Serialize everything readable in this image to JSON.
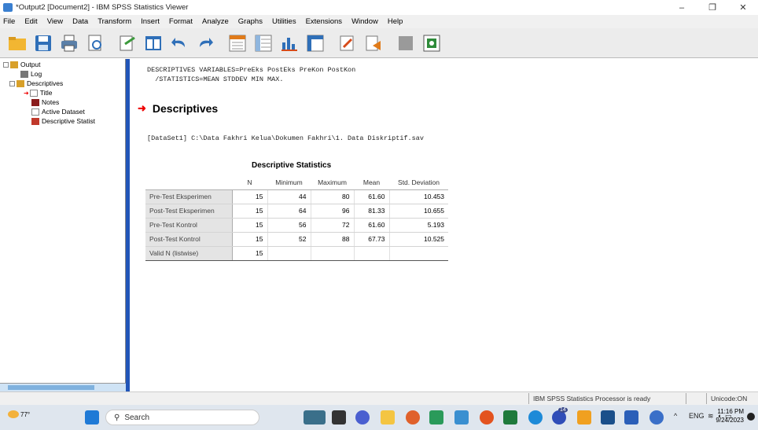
{
  "window": {
    "title": "*Output2 [Document2] - IBM SPSS Statistics Viewer",
    "minimize": "–",
    "maximize": "❐",
    "close": "✕"
  },
  "menu": [
    "File",
    "Edit",
    "View",
    "Data",
    "Transform",
    "Insert",
    "Format",
    "Analyze",
    "Graphs",
    "Utilities",
    "Extensions",
    "Window",
    "Help"
  ],
  "nav": {
    "items": [
      "Output",
      "Log",
      "Descriptives",
      "Title",
      "Notes",
      "Active Dataset",
      "Descriptive Statist"
    ]
  },
  "syntax": "DESCRIPTIVES VARIABLES=PreEks PostEks PreKon PostKon\n  /STATISTICS=MEAN STDDEV MIN MAX.",
  "section_heading": "Descriptives",
  "dataset_line": "[DataSet1] C:\\Data Fakhri Kelua\\Dokumen Fakhri\\1. Data Diskriptif.sav",
  "table": {
    "title": "Descriptive Statistics",
    "headers": [
      "",
      "N",
      "Minimum",
      "Maximum",
      "Mean",
      "Std. Deviation"
    ],
    "rows": [
      [
        "Pre-Test Eksperimen",
        "15",
        "44",
        "80",
        "61.60",
        "10.453"
      ],
      [
        "Post-Test Eksperimen",
        "15",
        "64",
        "96",
        "81.33",
        "10.655"
      ],
      [
        "Pre-Test Kontrol",
        "15",
        "56",
        "72",
        "61.60",
        "5.193"
      ],
      [
        "Post-Test Kontrol",
        "15",
        "52",
        "88",
        "67.73",
        "10.525"
      ],
      [
        "Valid N (listwise)",
        "15",
        "",
        "",
        "",
        ""
      ]
    ]
  },
  "status": {
    "processor": "IBM SPSS Statistics Processor is ready",
    "encoding": "Unicode:ON"
  },
  "taskbar": {
    "weather": "77°",
    "search_placeholder": "Search",
    "lang": "ENG",
    "time": "11:16 PM",
    "date": "9/24/2023",
    "badge": "14"
  }
}
